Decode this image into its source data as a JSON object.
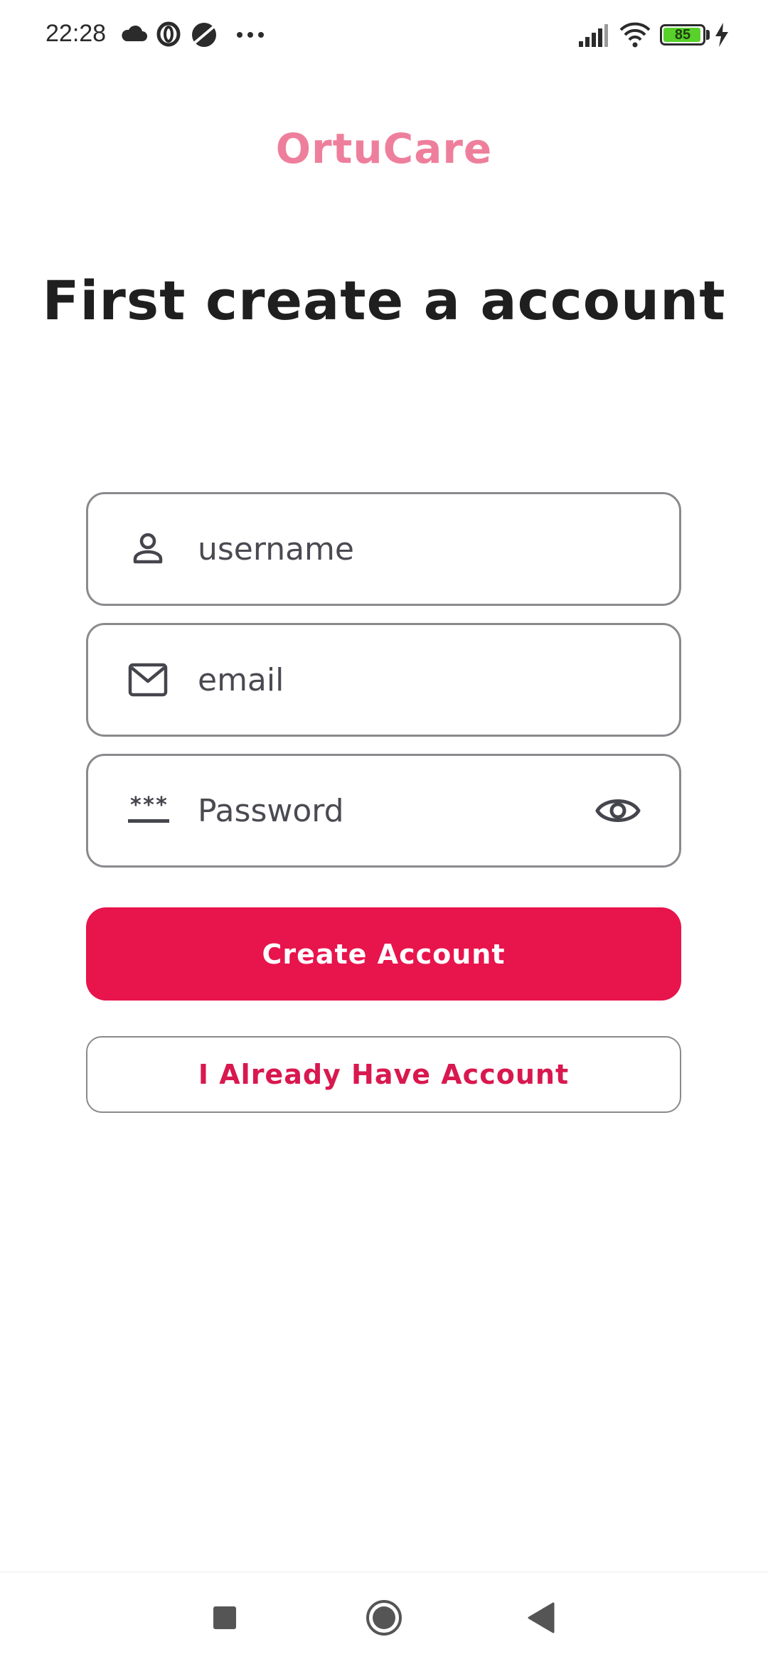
{
  "status_bar": {
    "time": "22:28",
    "battery_level": "85",
    "icons": [
      "cloud-icon",
      "opera-icon",
      "browser-icon",
      "more-dots-icon",
      "signal-icon",
      "wifi-icon",
      "battery-icon",
      "charging-icon"
    ]
  },
  "app": {
    "brand": "OrtuCare",
    "brand_color": "#ee7f9c",
    "heading": "First create a account"
  },
  "form": {
    "username": {
      "placeholder": "username",
      "value": "",
      "icon": "person-icon"
    },
    "email": {
      "placeholder": "email",
      "value": "",
      "icon": "mail-icon"
    },
    "password": {
      "placeholder": "Password",
      "value": "",
      "icon": "password-icon",
      "toggle_icon": "eye-icon"
    }
  },
  "actions": {
    "create_label": "Create Account",
    "create_color": "#e8144c",
    "login_label": "I Already Have Account",
    "login_color": "#d8184f"
  },
  "nav": {
    "items": [
      "recent-apps-icon",
      "home-icon",
      "back-icon"
    ]
  }
}
